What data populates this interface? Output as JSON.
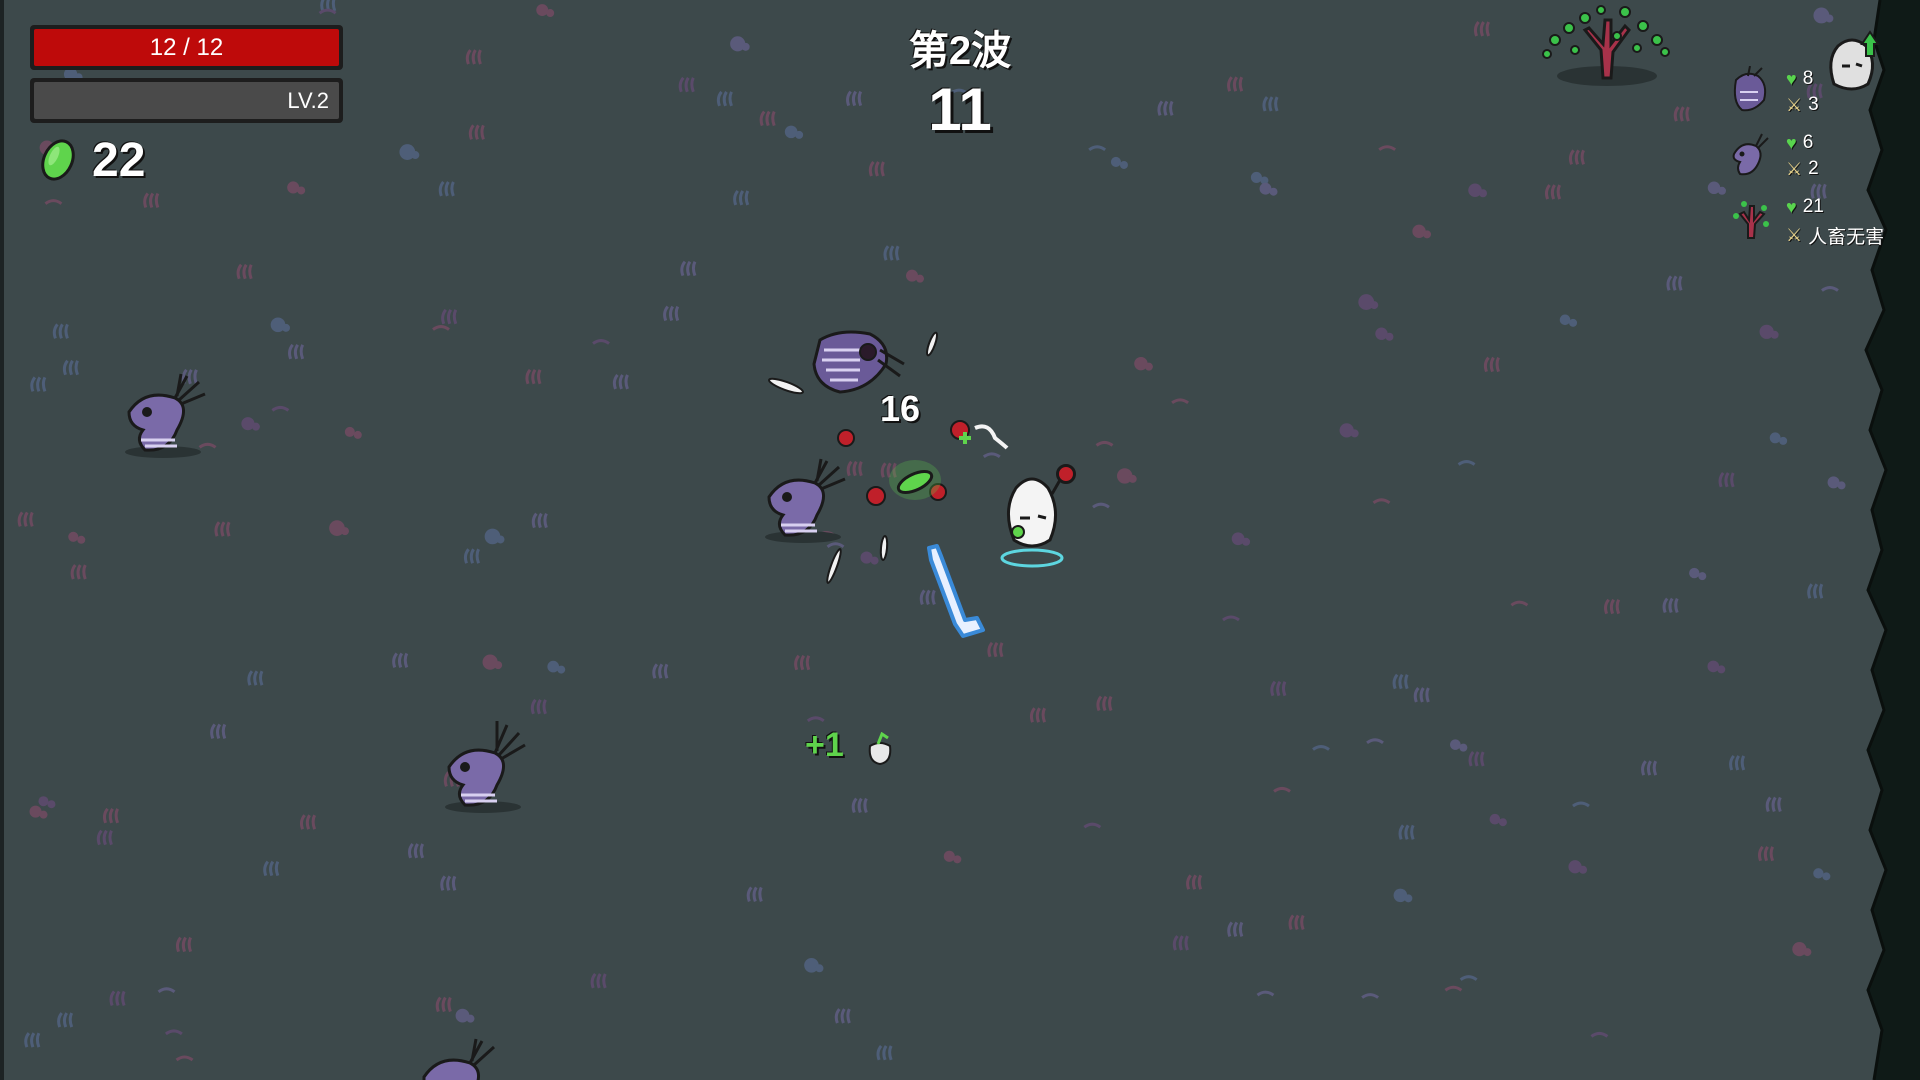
{
  "hud": {
    "hp_text": "12 / 12",
    "hp_fraction": 1.0,
    "level_text": "LV.2",
    "xp_fraction": 1.0,
    "materials_count": "22",
    "materials_icon": "green-material-icon"
  },
  "wave": {
    "title": "第2波",
    "timer": "11"
  },
  "enemy_info": [
    {
      "icon": "lamprey-alien-icon",
      "hp": "8",
      "damage": "3"
    },
    {
      "icon": "baby-alien-icon",
      "hp": "6",
      "damage": "2"
    },
    {
      "icon": "tree-icon",
      "hp": "21",
      "damage": "人畜无害"
    }
  ],
  "floating_texts": {
    "damage_number": "16",
    "material_pickup": "+1"
  },
  "colors": {
    "ground": "#3d494b",
    "hp_bar": "#be0a0a",
    "xp_bar": "#4a4a4a",
    "material_green": "#5fd44c",
    "enemy_purple": "#7a6aa8"
  }
}
